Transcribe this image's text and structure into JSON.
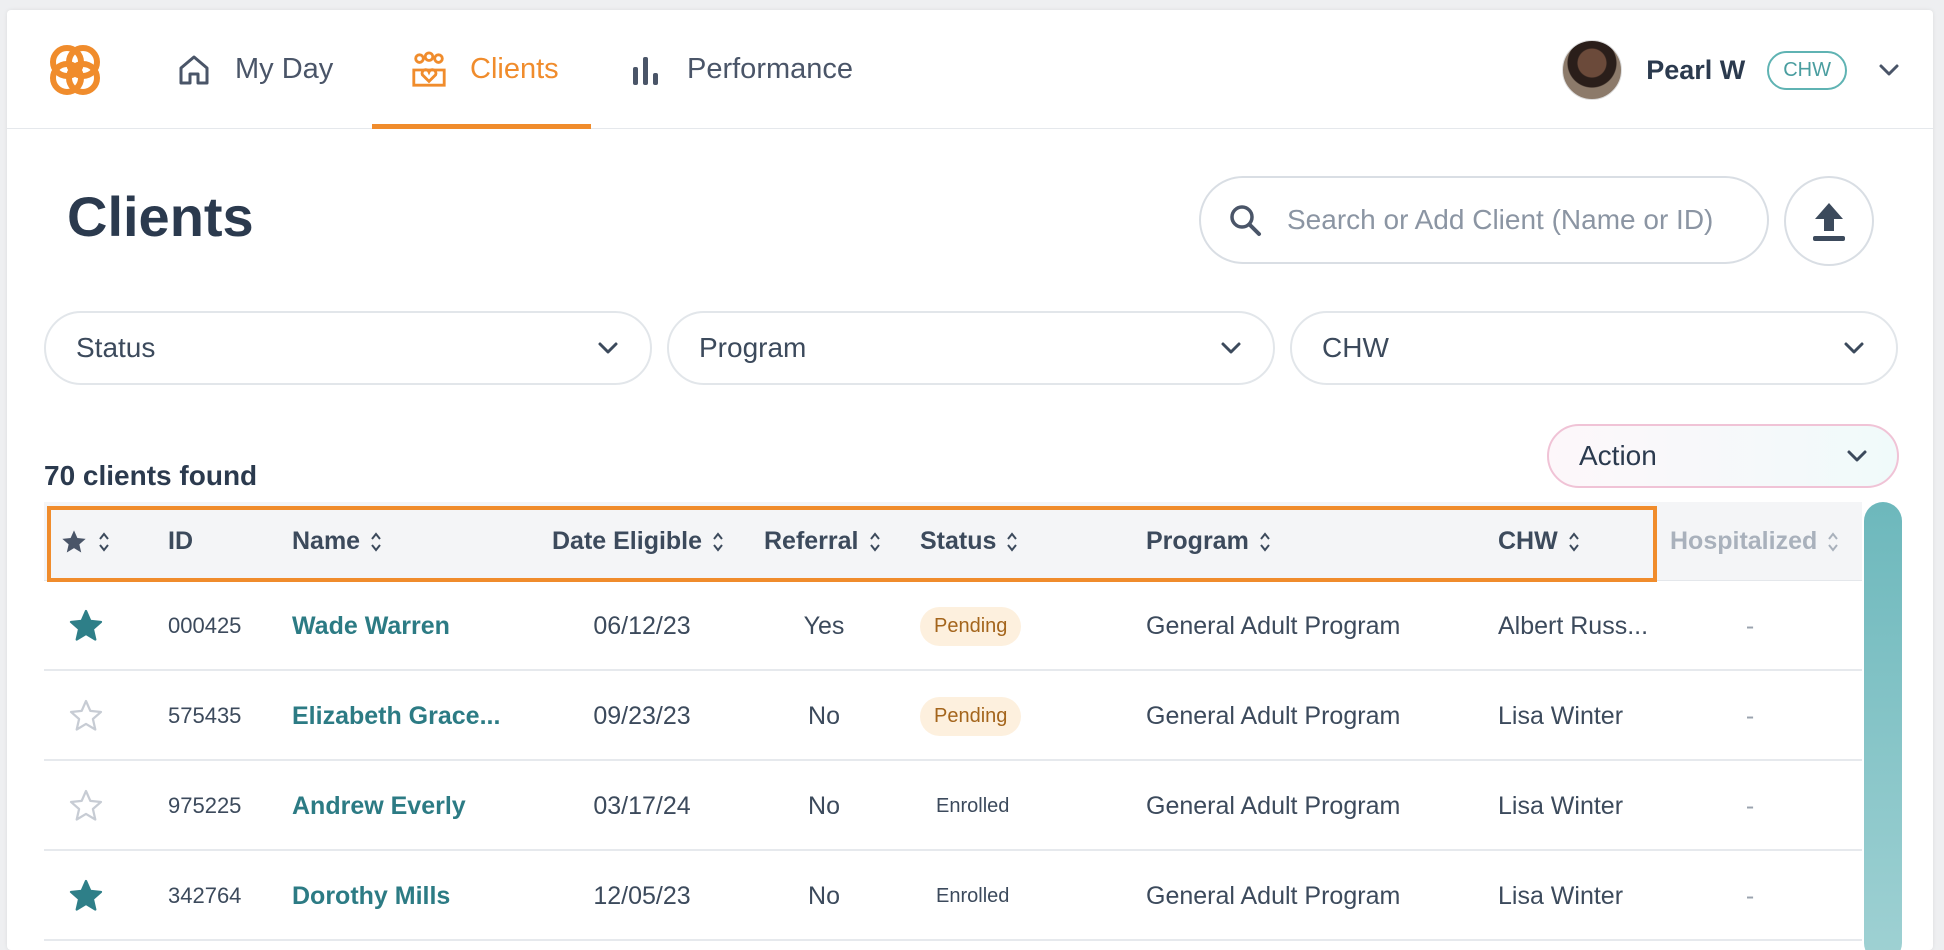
{
  "nav": {
    "my_day": "My Day",
    "clients": "Clients",
    "performance": "Performance"
  },
  "user": {
    "name": "Pearl W",
    "role": "CHW"
  },
  "page": {
    "title": "Clients"
  },
  "search": {
    "placeholder": "Search or Add Client (Name or ID)"
  },
  "filters": {
    "status": "Status",
    "program": "Program",
    "chw": "CHW"
  },
  "results": {
    "count_text": "70 clients found"
  },
  "action": {
    "label": "Action"
  },
  "table": {
    "headers": {
      "id": "ID",
      "name": "Name",
      "date_eligible": "Date Eligible",
      "referral": "Referral",
      "status": "Status",
      "program": "Program",
      "chw": "CHW",
      "hospitalized": "Hospitalized"
    },
    "rows": [
      {
        "starred": true,
        "id": "000425",
        "name": "Wade Warren",
        "date": "06/12/23",
        "referral": "Yes",
        "status": "Pending",
        "program": "General Adult Program",
        "chw": "Albert Russ...",
        "hospitalized": "-"
      },
      {
        "starred": false,
        "id": "575435",
        "name": "Elizabeth Grace...",
        "date": "09/23/23",
        "referral": "No",
        "status": "Pending",
        "program": "General Adult Program",
        "chw": "Lisa Winter",
        "hospitalized": "-"
      },
      {
        "starred": false,
        "id": "975225",
        "name": "Andrew Everly",
        "date": "03/17/24",
        "referral": "No",
        "status": "Enrolled",
        "program": "General Adult Program",
        "chw": "Lisa Winter",
        "hospitalized": "-"
      },
      {
        "starred": true,
        "id": "342764",
        "name": "Dorothy Mills",
        "date": "12/05/23",
        "referral": "No",
        "status": "Enrolled",
        "program": "General Adult Program",
        "chw": "Lisa Winter",
        "hospitalized": "-"
      }
    ]
  },
  "colors": {
    "accent": "#f08c2c",
    "teal": "#2c7b84",
    "star_filled": "#2e7f88",
    "star_empty": "#c7ccd4"
  }
}
